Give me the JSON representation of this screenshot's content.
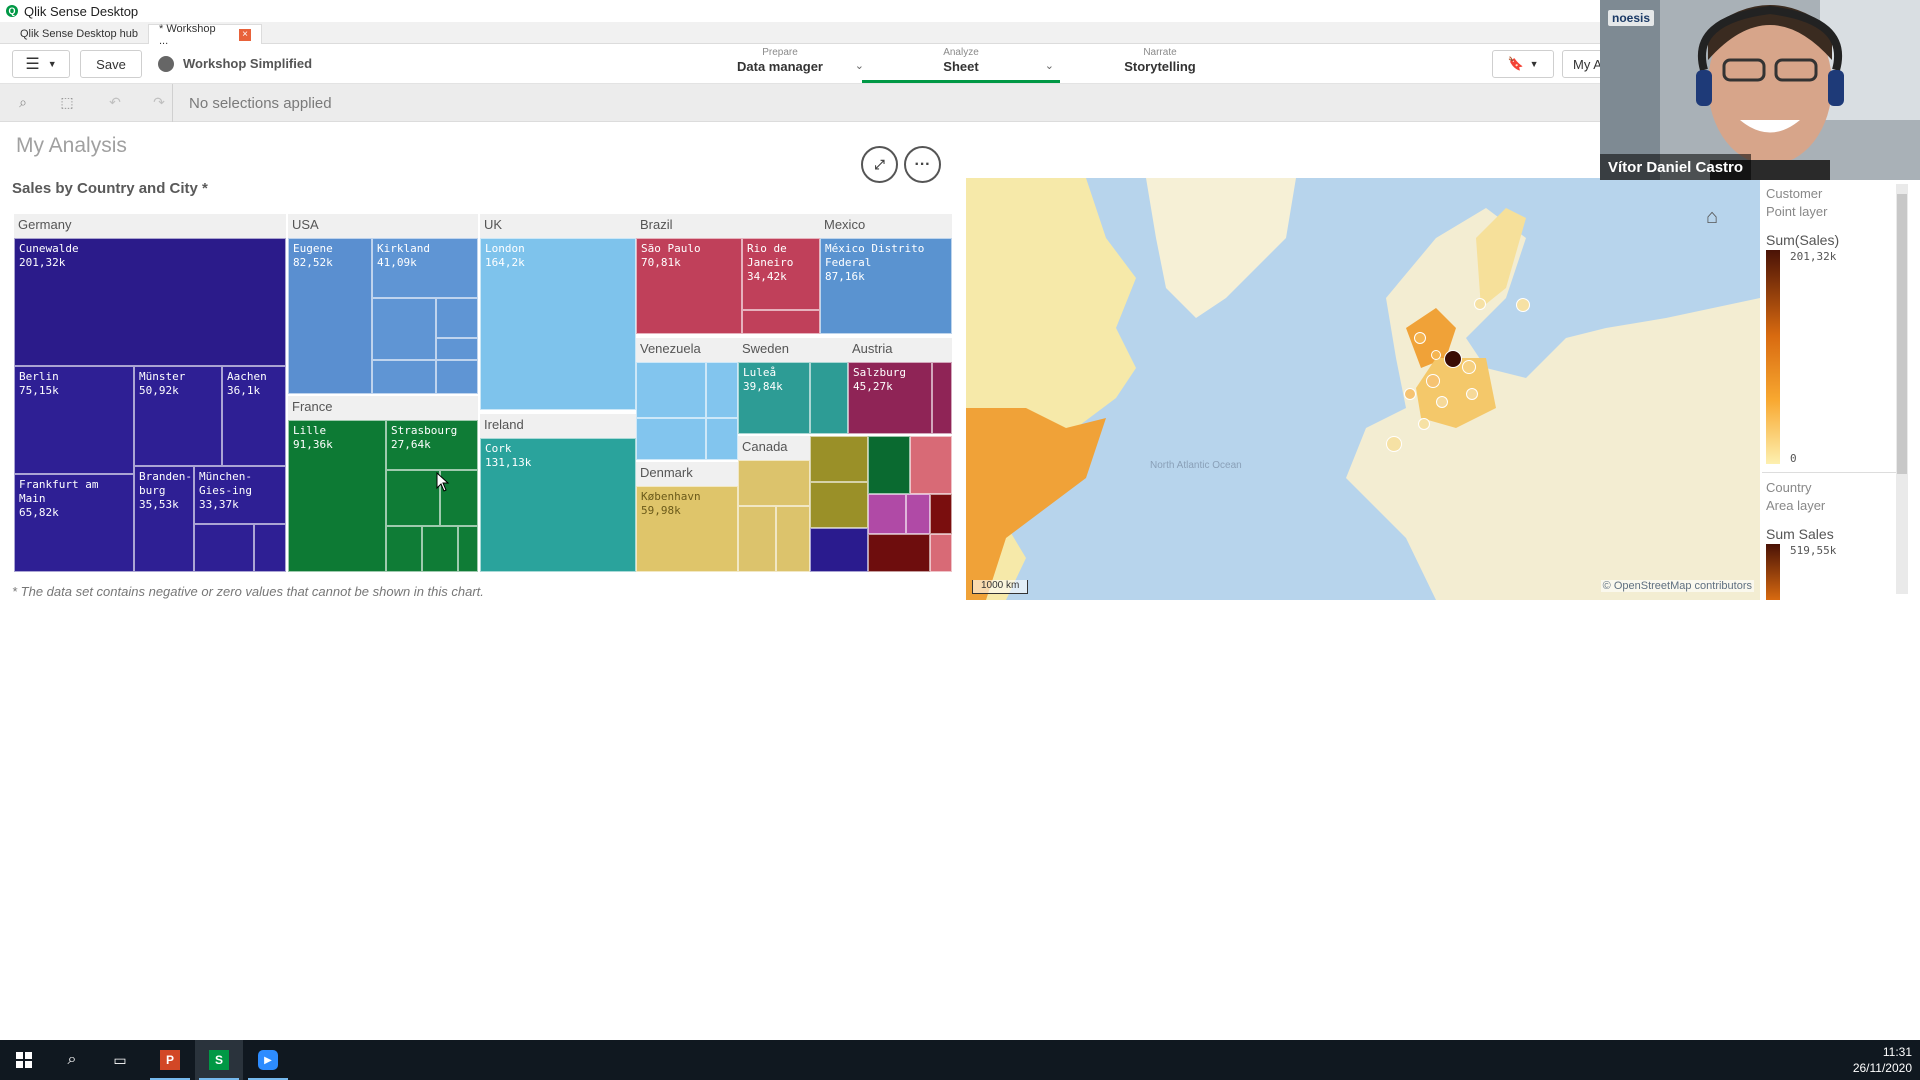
{
  "window": {
    "title": "Qlik Sense Desktop"
  },
  "tabs": [
    {
      "label": "Qlik Sense Desktop hub"
    },
    {
      "label": "* Workshop ...",
      "close": "×"
    }
  ],
  "toolbar": {
    "save_label": "Save",
    "app_name": "Workshop Simplified",
    "prepare_small": "Prepare",
    "prepare_big": "Data manager",
    "analyze_small": "Analyze",
    "analyze_big": "Sheet",
    "narrate_small": "Narrate",
    "narrate_big": "Storytelling",
    "right_label": "My A"
  },
  "selections": {
    "text": "No selections applied"
  },
  "sheet": {
    "title": "My Analysis",
    "chart_title": "Sales by Country and City *",
    "footnote": "* The data set contains negative or zero values that cannot be shown in this chart.",
    "expand_icon": "expand-icon",
    "more_icon": "more-icon",
    "more_glyph": "···"
  },
  "chart_data": [
    {
      "type": "treemap",
      "title": "Sales by Country and City *",
      "groups": [
        {
          "name": "Germany",
          "color": "#2b1b8a",
          "items": [
            {
              "label": "Cunewalde",
              "value": "201,32k"
            },
            {
              "label": "Berlin",
              "value": "75,15k"
            },
            {
              "label": "Münster",
              "value": "50,92k"
            },
            {
              "label": "Aachen",
              "value": "36,1k"
            },
            {
              "label": "Frankfurt am Main",
              "value": "65,82k"
            },
            {
              "label": "Branden-burg",
              "value": "35,53k"
            },
            {
              "label": "München-Gies-ing",
              "value": "33,37k"
            }
          ]
        },
        {
          "name": "USA",
          "color": "#5a8fd0",
          "items": [
            {
              "label": "Eugene",
              "value": "82,52k"
            },
            {
              "label": "Kirkland",
              "value": "41,09k"
            }
          ]
        },
        {
          "name": "France",
          "color": "#0d7a34",
          "items": [
            {
              "label": "Lille",
              "value": "91,36k"
            },
            {
              "label": "Strasbourg",
              "value": "27,64k"
            }
          ]
        },
        {
          "name": "UK",
          "color": "#7ec3ec",
          "items": [
            {
              "label": "London",
              "value": "164,2k"
            }
          ]
        },
        {
          "name": "Ireland",
          "color": "#2aa39c",
          "items": [
            {
              "label": "Cork",
              "value": "131,13k"
            }
          ]
        },
        {
          "name": "Brazil",
          "color": "#c0405a",
          "items": [
            {
              "label": "São Paulo",
              "value": "70,81k"
            },
            {
              "label": "Rio de Janeiro",
              "value": "34,42k"
            }
          ]
        },
        {
          "name": "Mexico",
          "color": "#5a93d0",
          "items": [
            {
              "label": "México Distrito Federal",
              "value": "87,16k"
            }
          ]
        },
        {
          "name": "Venezuela",
          "color": "#82c5ee",
          "items": []
        },
        {
          "name": "Sweden",
          "color": "#2d9c95",
          "items": [
            {
              "label": "Luleå",
              "value": "39,84k"
            }
          ]
        },
        {
          "name": "Austria",
          "color": "#8f2456",
          "items": [
            {
              "label": "Salzburg",
              "value": "45,27k"
            }
          ]
        },
        {
          "name": "Denmark",
          "color": "#dfc56a",
          "items": [
            {
              "label": "København",
              "value": "59,98k"
            }
          ]
        },
        {
          "name": "Canada",
          "color": "#dcc36c",
          "items": []
        }
      ]
    },
    {
      "type": "map",
      "legend": {
        "point_title": "Customer",
        "point_sub": "Point layer",
        "measure": "Sum(Sales)",
        "max": "201,32k",
        "min": "0",
        "area_title": "Country",
        "area_sub": "Area layer",
        "area_measure": "Sum Sales",
        "area_max": "519,55k"
      },
      "scale": "1000 km",
      "attribution": "© OpenStreetMap contributors",
      "ocean_label": "North Atlantic Ocean"
    }
  ],
  "webcam": {
    "brand": "noesis",
    "name": "Vítor Daniel Castro"
  },
  "taskbar": {
    "time": "11:31",
    "date": "26/11/2020"
  }
}
